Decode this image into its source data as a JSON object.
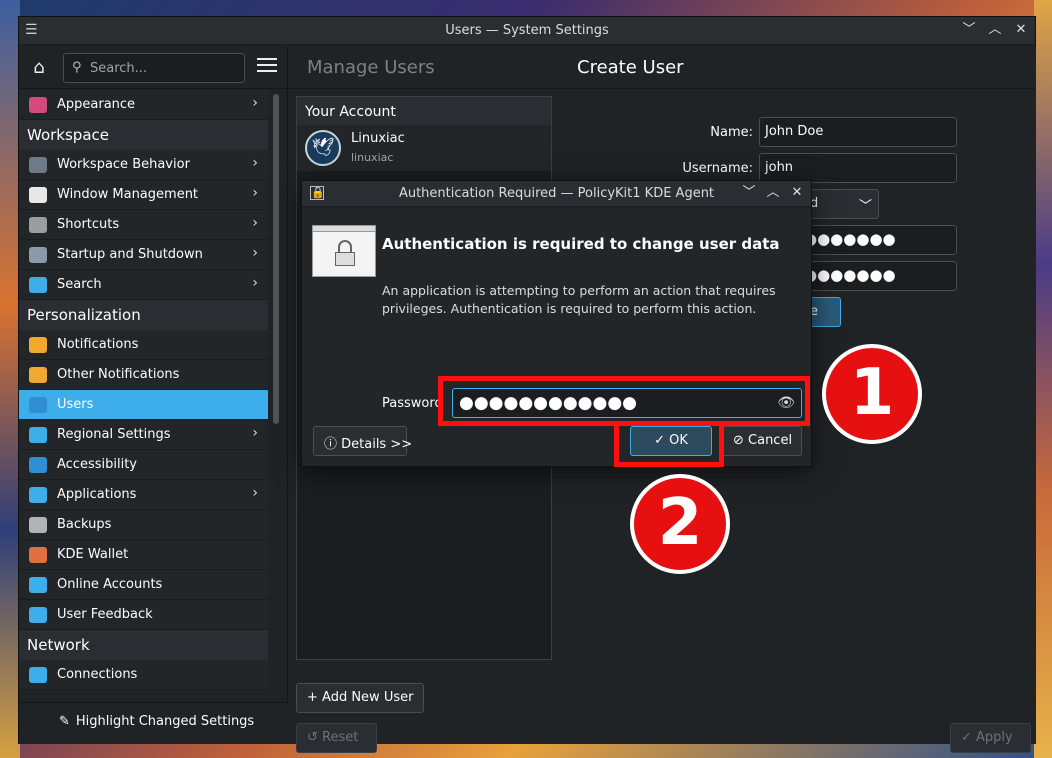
{
  "window": {
    "title": "Users — System Settings",
    "controls": [
      "﹀",
      "︿",
      "✕"
    ]
  },
  "sidebar": {
    "search_placeholder": "Search...",
    "items": [
      {
        "type": "item",
        "label": "Appearance",
        "icon": "appearance-icon",
        "color": "#d24b7a",
        "chevron": true
      },
      {
        "type": "category",
        "label": "Workspace"
      },
      {
        "type": "item",
        "label": "Workspace Behavior",
        "icon": "workspace-behavior-icon",
        "color": "#6c7a89",
        "chevron": true
      },
      {
        "type": "item",
        "label": "Window Management",
        "icon": "window-management-icon",
        "color": "#e8e8e8",
        "chevron": true
      },
      {
        "type": "item",
        "label": "Shortcuts",
        "icon": "keyboard-icon",
        "color": "#9a9ea2",
        "chevron": true
      },
      {
        "type": "item",
        "label": "Startup and Shutdown",
        "icon": "startup-icon",
        "color": "#8a9aa8",
        "chevron": true
      },
      {
        "type": "item",
        "label": "Search",
        "icon": "search-icon",
        "color": "#3daee9",
        "chevron": true
      },
      {
        "type": "category",
        "label": "Personalization"
      },
      {
        "type": "item",
        "label": "Notifications",
        "icon": "bell-icon",
        "color": "#f0a830",
        "chevron": false
      },
      {
        "type": "item",
        "label": "Other Notifications",
        "icon": "bell-icon",
        "color": "#f0a830",
        "chevron": false
      },
      {
        "type": "item",
        "label": "Users",
        "icon": "users-icon",
        "color": "#2f8fd0",
        "chevron": false,
        "active": true
      },
      {
        "type": "item",
        "label": "Regional Settings",
        "icon": "regional-settings-icon",
        "color": "#3daee9",
        "chevron": true
      },
      {
        "type": "item",
        "label": "Accessibility",
        "icon": "accessibility-icon",
        "color": "#2f8fd0",
        "chevron": false
      },
      {
        "type": "item",
        "label": "Applications",
        "icon": "applications-icon",
        "color": "#3daee9",
        "chevron": true
      },
      {
        "type": "item",
        "label": "Backups",
        "icon": "backups-icon",
        "color": "#b0b4b8",
        "chevron": false
      },
      {
        "type": "item",
        "label": "KDE Wallet",
        "icon": "wallet-icon",
        "color": "#e07040",
        "chevron": false
      },
      {
        "type": "item",
        "label": "Online Accounts",
        "icon": "globe-icon",
        "color": "#3daee9",
        "chevron": false
      },
      {
        "type": "item",
        "label": "User Feedback",
        "icon": "feedback-icon",
        "color": "#3daee9",
        "chevron": false
      },
      {
        "type": "category",
        "label": "Network"
      },
      {
        "type": "item",
        "label": "Connections",
        "icon": "globe-icon",
        "color": "#3daee9",
        "chevron": false
      }
    ],
    "highlight_button": "Highlight Changed Settings"
  },
  "content": {
    "header_left": "Manage Users",
    "header_right": "Create User",
    "your_account": "Your Account",
    "account_name": "Linuxiac",
    "account_user": "linuxiac",
    "add_user": "+ Add New User",
    "reset": "↺ Reset",
    "apply": "✓ Apply",
    "form": {
      "name_label": "Name:",
      "name_value": "John Doe",
      "username_label": "Username:",
      "username_value": "john",
      "account_type_partial": "d",
      "password_partial": "●●●●●●●",
      "confirm_partial": "●●●●●●●",
      "create_partial": "e"
    }
  },
  "dialog": {
    "title": "Authentication Required — PolicyKit1 KDE Agent",
    "heading": "Authentication is required to change user data",
    "description": "An application is attempting to perform an action that requires privileges. Authentication is required to perform this action.",
    "password_label": "Password",
    "password_value": "●●●●●●●●●●●●",
    "details_button": "ⓘ Details >>",
    "ok_button": "✓ OK",
    "cancel_button": "⊘ Cancel"
  },
  "annotations": {
    "badge_1": "1",
    "badge_2": "2",
    "highlight_color": "#ff1010"
  }
}
